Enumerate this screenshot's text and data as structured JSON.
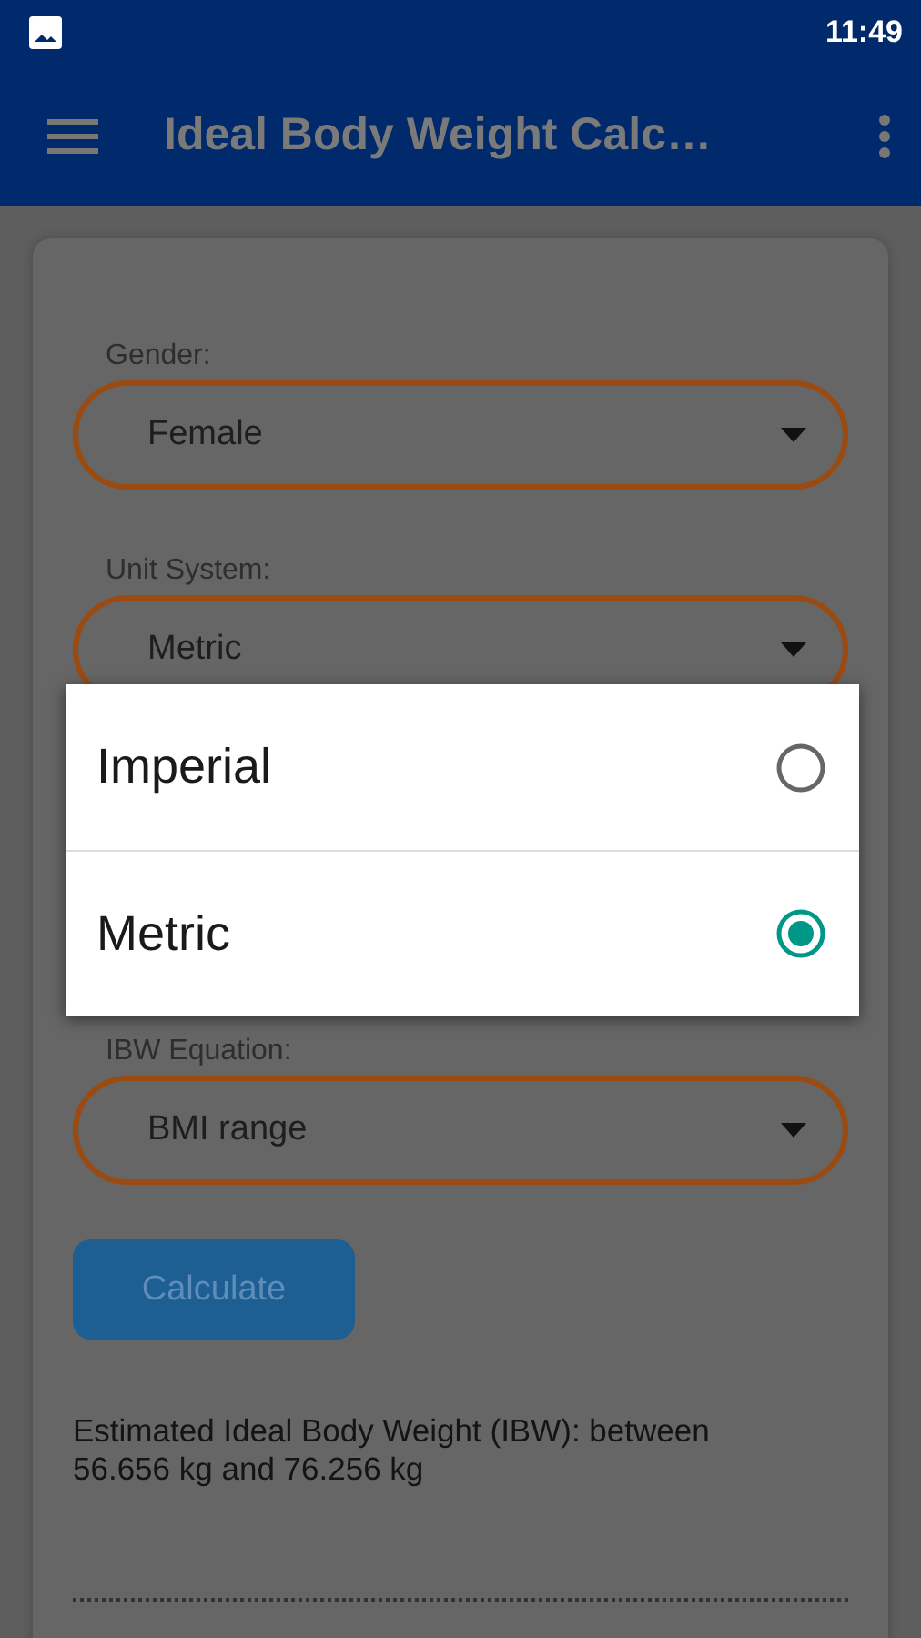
{
  "status_bar": {
    "time": "11:49"
  },
  "app_bar": {
    "title": "Ideal Body Weight Calc…"
  },
  "form": {
    "fields": [
      {
        "label": "Gender:",
        "value": "Female"
      },
      {
        "label": "Unit System:",
        "value": "Metric"
      },
      {
        "label": "IBW Equation:",
        "value": "BMI range"
      }
    ],
    "button": "Calculate",
    "result": "Estimated Ideal Body Weight (IBW): between 56.656 kg and 76.256 kg"
  },
  "dialog": {
    "options": [
      {
        "label": "Imperial",
        "selected": false
      },
      {
        "label": "Metric",
        "selected": true
      }
    ]
  }
}
